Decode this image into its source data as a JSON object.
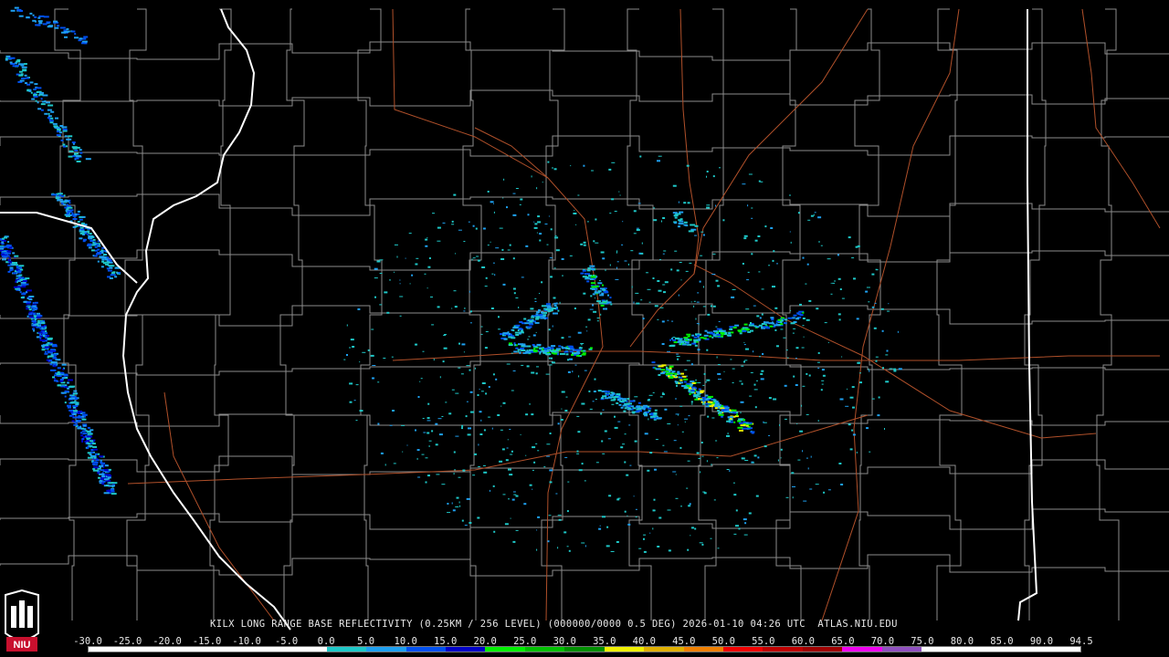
{
  "caption": {
    "text": "KILX LONG RANGE BASE REFLECTIVITY (0.25KM / 256 LEVEL) (000000/0000 0.5 DEG) 2026-01-10 04:26 UTC  ATLAS.NIU.EDU"
  },
  "logo": {
    "text": "NIU",
    "colors": {
      "red": "#c8102e",
      "white": "#ffffff",
      "black": "#000000"
    }
  },
  "colorbar": {
    "labels": [
      "-30.0",
      "-25.0",
      "-20.0",
      "-15.0",
      "-10.0",
      "-5.0",
      "0.0",
      "5.0",
      "10.0",
      "15.0",
      "20.0",
      "25.0",
      "30.0",
      "35.0",
      "40.0",
      "45.0",
      "50.0",
      "55.0",
      "60.0",
      "65.0",
      "70.0",
      "75.0",
      "80.0",
      "85.0",
      "90.0",
      "94.5"
    ],
    "colors": [
      "#ffffff",
      "#ffffff",
      "#ffffff",
      "#ffffff",
      "#ffffff",
      "#ffffff",
      "#1ec8c8",
      "#1ea0f0",
      "#0050f0",
      "#0000c8",
      "#00f000",
      "#00c000",
      "#009000",
      "#f0f000",
      "#e0b000",
      "#f08000",
      "#f00000",
      "#c00000",
      "#a00000",
      "#f000f0",
      "#9050c0",
      "#ffffff",
      "#ffffff",
      "#ffffff",
      "#ffffff"
    ]
  },
  "map": {
    "background": "#000000",
    "county_line_color": "#8c8c8c",
    "state_line_color": "#ffffff",
    "highway_color": "#b0502a",
    "echo_colors": [
      "#1ec8c8",
      "#1ea0f0",
      "#0050f0",
      "#0000c8",
      "#00f000",
      "#00c000",
      "#f0f000"
    ]
  }
}
